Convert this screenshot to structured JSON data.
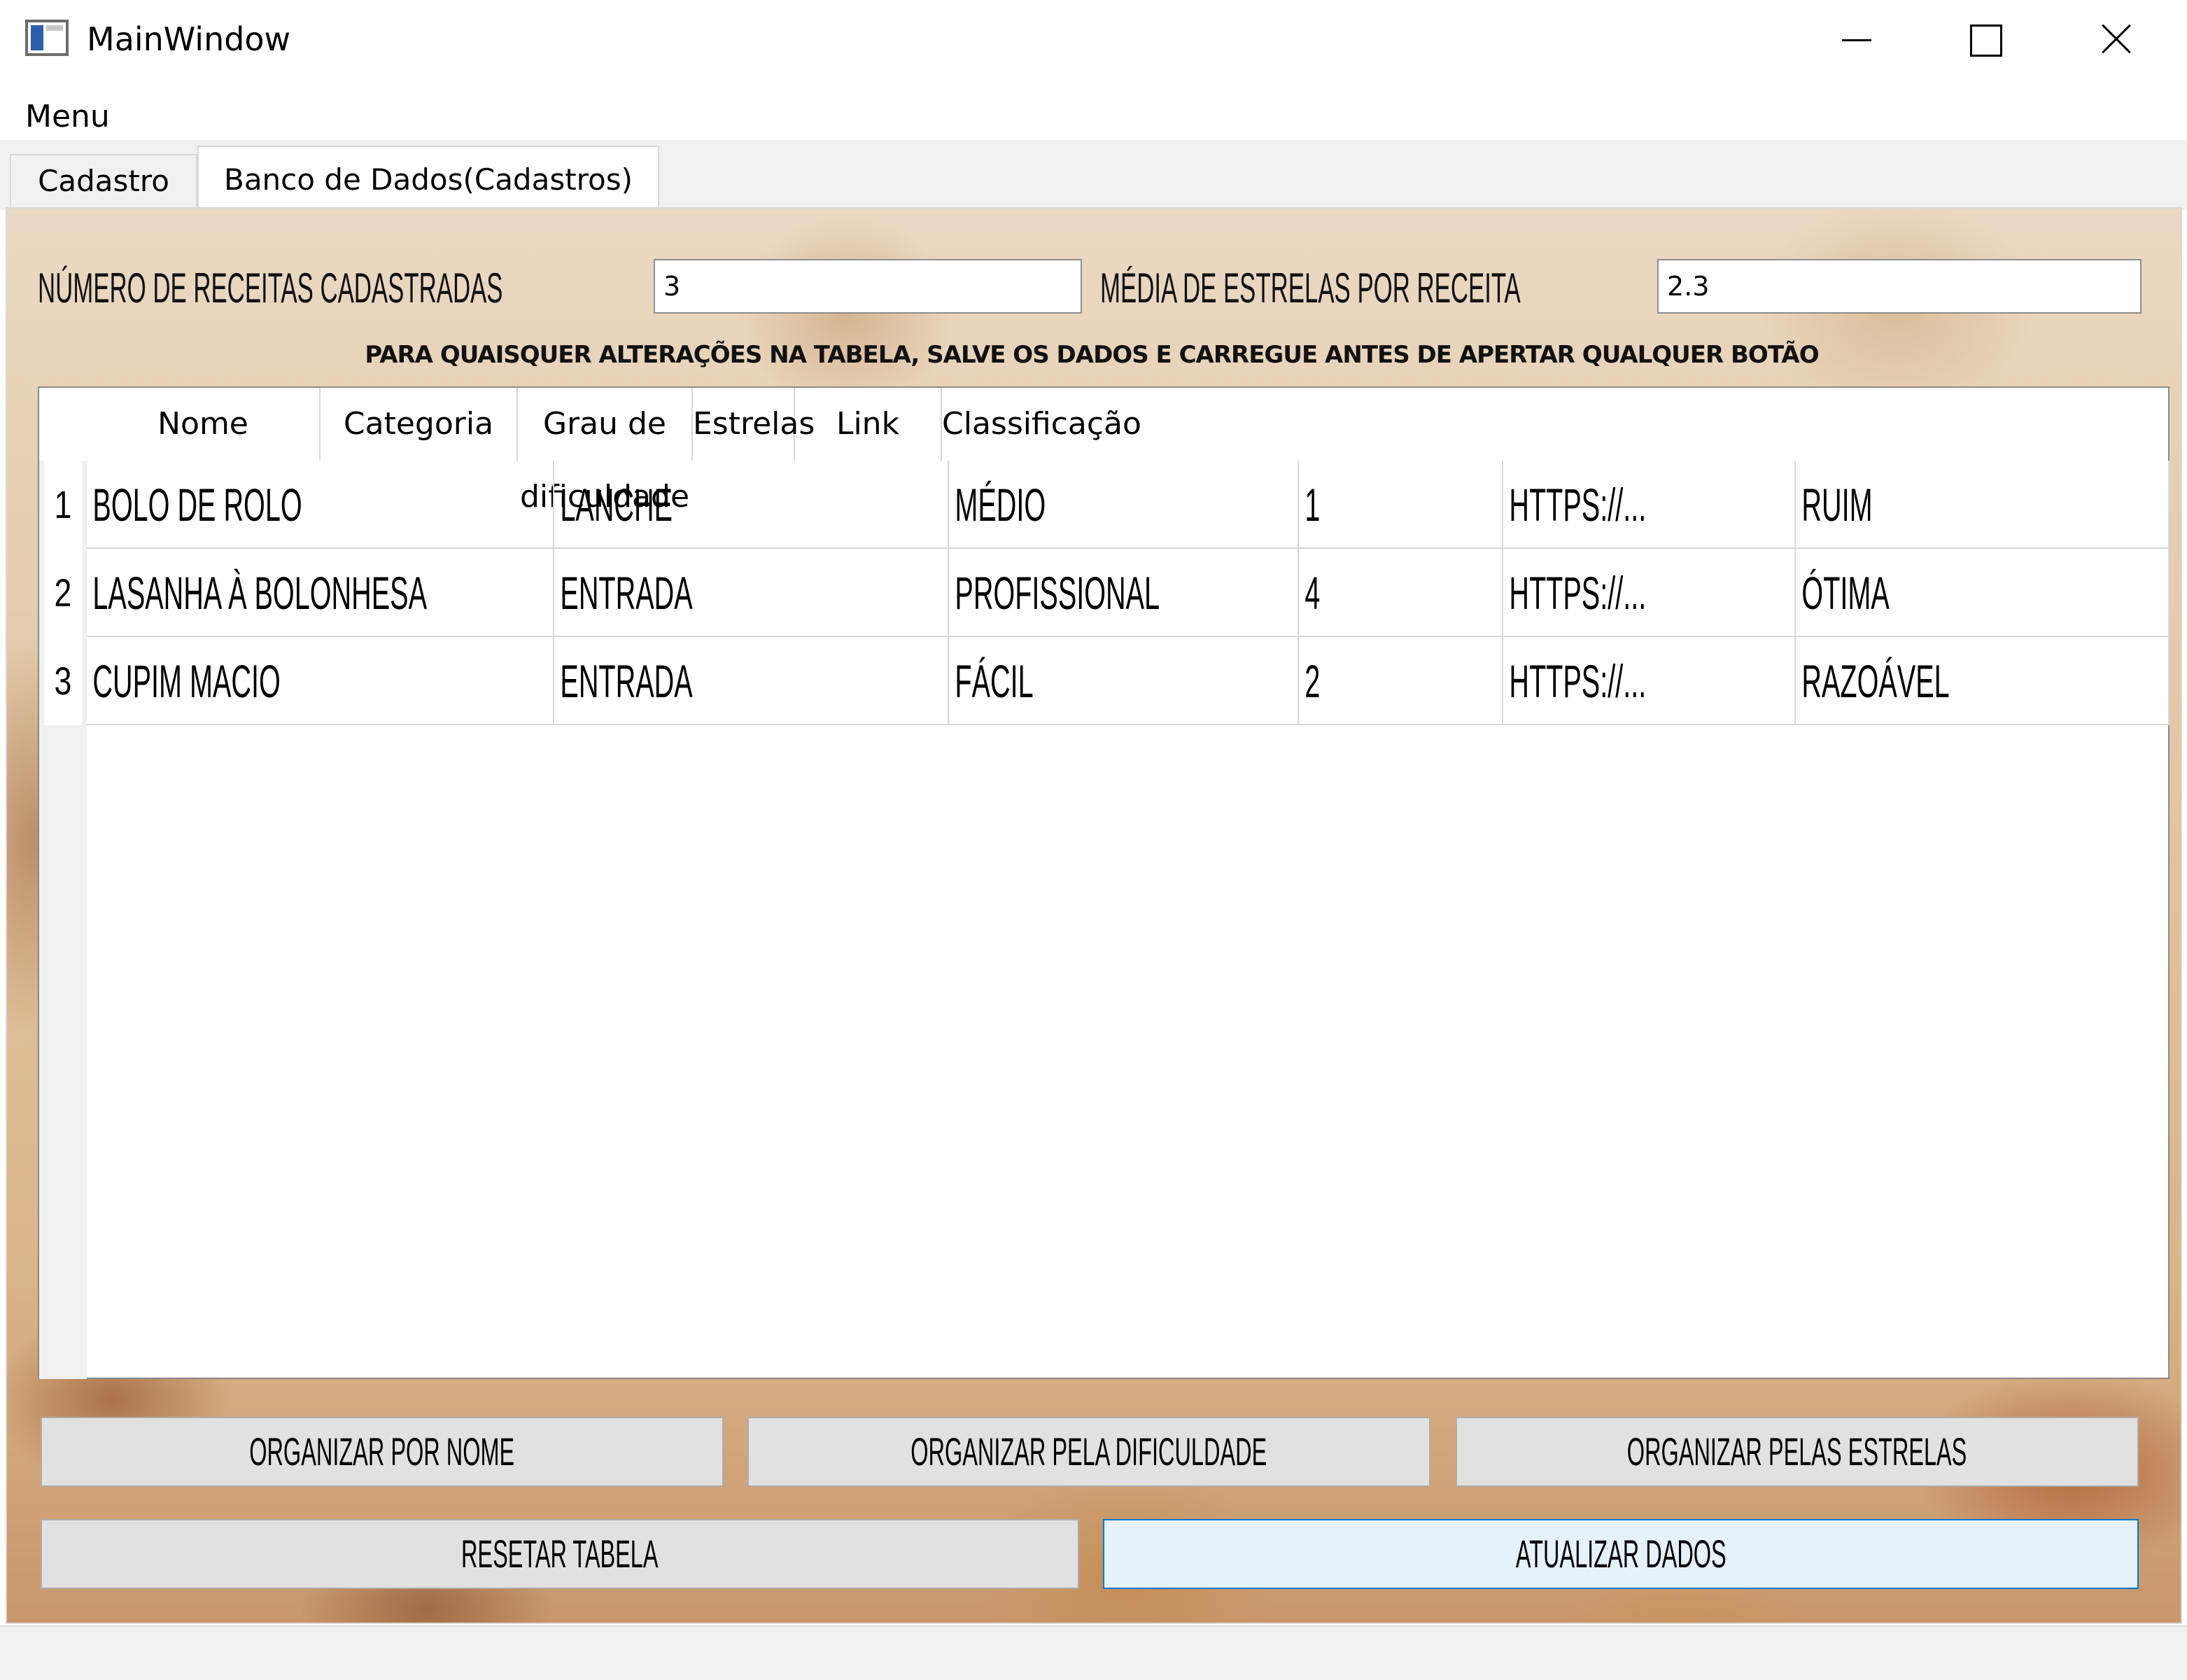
{
  "window": {
    "title": "MainWindow",
    "controls": [
      "minimize-icon",
      "maximize-icon",
      "close-icon"
    ]
  },
  "menu": {
    "label": "Menu"
  },
  "tabs": [
    {
      "label": "Cadastro",
      "active": false
    },
    {
      "label": "Banco de Dados(Cadastros)",
      "active": true
    }
  ],
  "stats": {
    "num_label": "NÚMERO DE RECEITAS CADASTRADAS",
    "num_value": "3",
    "media_label": "MÉDIA DE ESTRELAS POR RECEITA",
    "media_value": "2.3"
  },
  "warning": "PARA QUAISQUER ALTERAÇÕES NA TABELA, SALVE OS DADOS E CARREGUE ANTES DE APERTAR QUALQUER BOTÃO",
  "table": {
    "columns": [
      "Nome",
      "Categoria",
      "Grau de dificuldade",
      "Estrelas",
      "Link",
      "Classificação"
    ],
    "rows": [
      {
        "num": "1",
        "cells": [
          "BOLO DE ROLO",
          "LANCHE",
          "MÉDIO",
          "1",
          "HTTPS://...",
          "RUIM"
        ]
      },
      {
        "num": "2",
        "cells": [
          "LASANHA À BOLONHESA",
          "ENTRADA",
          "PROFISSIONAL",
          "4",
          "HTTPS://...",
          "ÓTIMA"
        ]
      },
      {
        "num": "3",
        "cells": [
          " CUPIM MACIO",
          "ENTRADA",
          "FÁCIL",
          "2",
          "HTTPS://...",
          "RAZOÁVEL"
        ]
      }
    ]
  },
  "buttons": {
    "sort_name": "ORGANIZAR POR NOME",
    "sort_difficulty": "ORGANIZAR PELA DIFICULDADE",
    "sort_stars": "ORGANIZAR PELAS ESTRELAS",
    "reset": "RESETAR TABELA",
    "update": "ATUALIZAR DADOS"
  },
  "colors": {
    "focus_border": "#0078d7",
    "button_bg": "#e1e1e1",
    "tab_bg": "#f0f0f0"
  }
}
